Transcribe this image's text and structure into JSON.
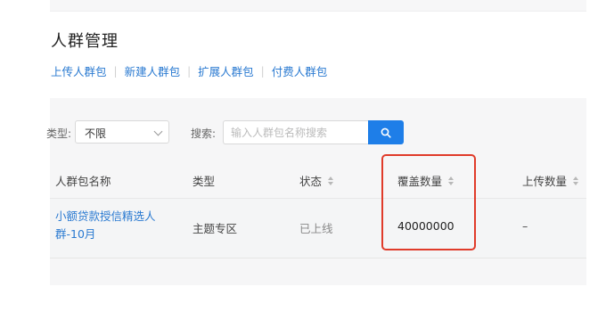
{
  "page": {
    "title": "人群管理"
  },
  "nav_links": [
    {
      "label": "上传人群包"
    },
    {
      "label": "新建人群包"
    },
    {
      "label": "扩展人群包"
    },
    {
      "label": "付费人群包"
    }
  ],
  "filters": {
    "type_label": "类型:",
    "type_selected": "不限",
    "search_label": "搜索:",
    "search_placeholder": "输入人群包名称搜索"
  },
  "table": {
    "columns": [
      "人群包名称",
      "类型",
      "状态",
      "覆盖数量",
      "上传数量"
    ],
    "rows": [
      {
        "name": "小额贷款授信精选人群-10月",
        "type": "主题专区",
        "status": "已上线",
        "count": "40000000",
        "upload": "–"
      }
    ]
  },
  "colors": {
    "accent": "#1e7ee8",
    "link": "#2a7ad1",
    "highlight": "#e03b2a"
  }
}
